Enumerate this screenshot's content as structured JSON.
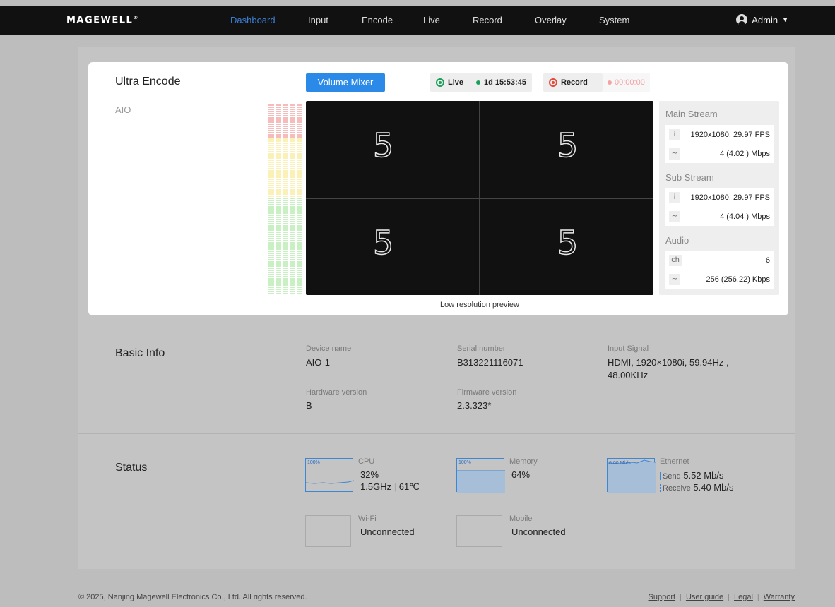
{
  "nav": {
    "logo": "MAGEWELL",
    "items": [
      "Dashboard",
      "Input",
      "Encode",
      "Live",
      "Record",
      "Overlay",
      "System"
    ],
    "user": "Admin"
  },
  "card": {
    "title": "Ultra Encode",
    "subtitle": "AIO",
    "volume_mixer": "Volume Mixer",
    "live_label": "Live",
    "live_time": "1d 15:53:45",
    "record_label": "Record",
    "record_time": "00:00:00",
    "preview_digit": "5",
    "preview_caption": "Low resolution preview",
    "colors": {
      "accent": "#2b8ae8",
      "live": "#1aa05a",
      "record": "#e64a3a"
    }
  },
  "streams": {
    "main_title": "Main Stream",
    "main_res": "1920x1080, 29.97 FPS",
    "main_rate": "4 (4.02 ) Mbps",
    "sub_title": "Sub Stream",
    "sub_res": "1920x1080, 29.97 FPS",
    "sub_rate": "4 (4.04 ) Mbps",
    "audio_title": "Audio",
    "audio_ch_icon": "ch",
    "audio_ch": "6",
    "audio_rate": "256 (256.22) Kbps"
  },
  "basic": {
    "title": "Basic Info",
    "device_name_label": "Device name",
    "device_name": "AIO-1",
    "serial_label": "Serial number",
    "serial": "B313221116071",
    "input_label": "Input Signal",
    "input_line1": "HDMI, 1920×1080i, 59.94Hz ,",
    "input_line2": "48.00KHz",
    "hw_label": "Hardware version",
    "hw": "B",
    "fw_label": "Firmware version",
    "fw": "2.3.323*"
  },
  "status": {
    "title": "Status",
    "cpu_label": "CPU",
    "cpu_pct": "32%",
    "cpu_freq": "1.5GHz",
    "cpu_temp": "61℃",
    "cpu_graph_max": "100%",
    "mem_label": "Memory",
    "mem_pct": "64%",
    "mem_graph_max": "100%",
    "eth_label": "Ethernet",
    "eth_graph_max": "6.00 Mb/s",
    "send_label": "Send",
    "send_val": "5.52 Mb/s",
    "recv_label": "Receive",
    "recv_val": "5.40 Mb/s",
    "wifi_label": "Wi-Fi",
    "wifi_val": "Unconnected",
    "mobile_label": "Mobile",
    "mobile_val": "Unconnected"
  },
  "footer": {
    "copyright": "© 2025, Nanjing Magewell Electronics Co., Ltd. All rights reserved.",
    "support": "Support",
    "guide": "User guide",
    "legal": "Legal",
    "warranty": "Warranty"
  }
}
